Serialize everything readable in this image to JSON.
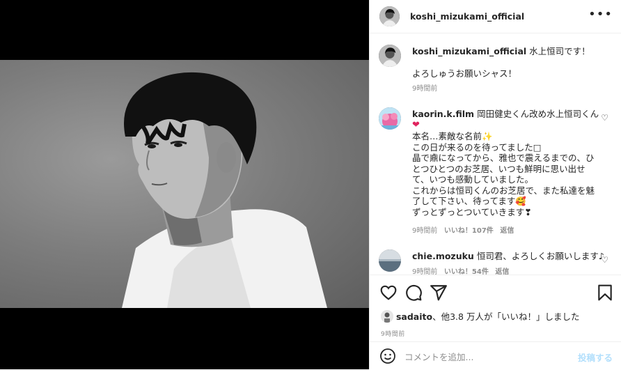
{
  "post": {
    "author": "koshi_mizukami_official",
    "caption_line1": "水上恒司です！",
    "caption_line2": "よろしゅうお願いシャス！",
    "caption_time": "9時間前"
  },
  "comments": [
    {
      "user": "kaorin.k.film",
      "lines": [
        "岡田健史くん改め水上恒司くん",
        "❤",
        "本名…素敵な名前✨",
        "この日が来るのを待ってました□",
        "晶で鼑になってから、雅也で震えるまでの、ひ",
        "とつひとつのお芝居、いつも鮮明に思い出せ",
        "て、いつも感動していました。",
        "これからは恒司くんのお芝居で、また私達を魅",
        "了して下さい、待ってます🥰",
        "ずっとずっとついていきます❣"
      ],
      "time": "9時間前",
      "likes": "いいね！107件",
      "reply": "返信"
    },
    {
      "user": "chie.mozuku",
      "text": "恒司君、よろしくお願いします♪",
      "time": "9時間前",
      "likes": "いいね！54件",
      "reply": "返信"
    }
  ],
  "likes_line": {
    "user": "sadaito",
    "rest": "、他3.8 万人が「いいね！」しました"
  },
  "post_time": "9時間前",
  "add_comment": {
    "placeholder": "コメントを追加...",
    "post_label": "投稿する"
  },
  "icons": {
    "more": "more-icon",
    "heart": "heart-icon",
    "comment": "comment-icon",
    "share": "share-icon",
    "save": "bookmark-icon",
    "emoji": "emoji-icon"
  }
}
